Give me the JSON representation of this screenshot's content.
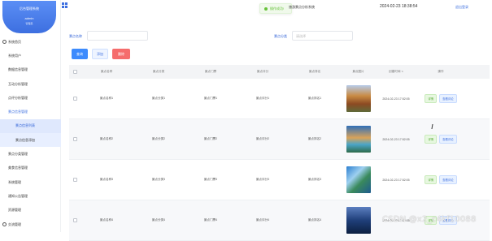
{
  "profile": {
    "system_name": "后台管理系统",
    "user": "admin",
    "role": "管理员"
  },
  "menu": [
    {
      "label": "系统首页",
      "type": "icon"
    },
    {
      "label": "系统用户",
      "type": "item"
    },
    {
      "label": "数据信息管理",
      "type": "item"
    },
    {
      "label": "互动分析管理",
      "type": "item"
    },
    {
      "label": "点评分析管理",
      "type": "item"
    },
    {
      "label": "景点信息管理",
      "type": "active"
    },
    {
      "label": "景点信息列表",
      "type": "sub-selected"
    },
    {
      "label": "景点信息添加",
      "type": "sub"
    },
    {
      "label": "景点分类管理",
      "type": "item"
    },
    {
      "label": "美食信息管理",
      "type": "item"
    },
    {
      "label": "系统管理",
      "type": "item"
    },
    {
      "label": "通知公告管理",
      "type": "item"
    },
    {
      "label": "资源管理",
      "type": "item"
    },
    {
      "label": "交流管理",
      "type": "icon"
    }
  ],
  "topbar": {
    "system_title": "旅游景点分析系统",
    "datetime": "2024-02-23 18:38:54",
    "home_link": "退出登录",
    "toast": "操作成功!"
  },
  "filters": {
    "name_label": "景点名称",
    "name_placeholder": "",
    "category_label": "景点分类",
    "category_placeholder": "请选择"
  },
  "buttons": {
    "search": "查询",
    "add": "添加",
    "delete": "删除"
  },
  "table": {
    "headers": [
      "景点名称",
      "景点分类",
      "景点门票",
      "景点评分",
      "景点排名",
      "景点图片",
      "创建时间",
      "操作"
    ],
    "rows": [
      {
        "name": "景点名称1",
        "category": "景点分类1",
        "ticket": "景点门票1",
        "score": "景点评分1",
        "rank": "景点排名1",
        "created": "2024-02-23 17:52:05",
        "thumb": "th1"
      },
      {
        "name": "景点名称2",
        "category": "景点分类2",
        "ticket": "景点门票2",
        "score": "景点评分2",
        "rank": "景点排名2",
        "created": "2024-02-23 17:52:05",
        "thumb": "th2"
      },
      {
        "name": "景点名称3",
        "category": "景点分类3",
        "ticket": "景点门票3",
        "score": "景点评分3",
        "rank": "景点排名3",
        "created": "2024-02-23 17:52:05",
        "thumb": "th3"
      },
      {
        "name": "景点名称4",
        "category": "景点分类4",
        "ticket": "景点门票4",
        "score": "景点评分4",
        "rank": "景点排名4",
        "created": "2024-02-23 17:52:05",
        "thumb": "th4"
      }
    ],
    "action_detail": "详情",
    "action_review": "查看评论"
  },
  "watermark": "CSDN @x2_c4kf10088",
  "colors": {
    "primary": "#3d6fe0",
    "success": "#67c23a",
    "danger": "#f56c6c"
  }
}
